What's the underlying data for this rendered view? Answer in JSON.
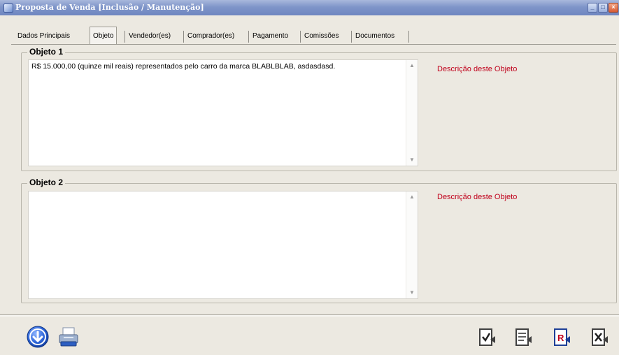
{
  "window": {
    "title": "Proposta de Venda [Inclusão / Manutenção]",
    "icon": "app-window-icon",
    "controls": [
      "minimize",
      "maximize",
      "close"
    ]
  },
  "tabs": [
    {
      "label": "Dados Principais",
      "active": false
    },
    {
      "label": "Objeto",
      "active": true
    },
    {
      "label": "Vendedor(es)",
      "active": false
    },
    {
      "label": "Comprador(es)",
      "active": false
    },
    {
      "label": "Pagamento",
      "active": false
    },
    {
      "label": "Comissões",
      "active": false
    },
    {
      "label": "Documentos",
      "active": false
    }
  ],
  "objeto1": {
    "legend": "Objeto 1",
    "value": "R$ 15.000,00 (quinze mil reais) representados pelo carro da marca BLABLBLAB, asdasdasd.",
    "description": "Descrição deste Objeto"
  },
  "objeto2": {
    "legend": "Objeto 2",
    "value": "",
    "description": "Descrição deste Objeto"
  },
  "toolbar": {
    "left_icons": [
      "download-circle-icon",
      "printer-icon"
    ],
    "right_icons": [
      "confirm-document-icon",
      "document-arrow-icon",
      "report-document-icon",
      "cancel-document-icon"
    ]
  },
  "colors": {
    "title_bar": "#7f95c9",
    "description_text": "#c0001b",
    "window_bg": "#ece9e1",
    "accent_blue": "#1e5bd6"
  }
}
